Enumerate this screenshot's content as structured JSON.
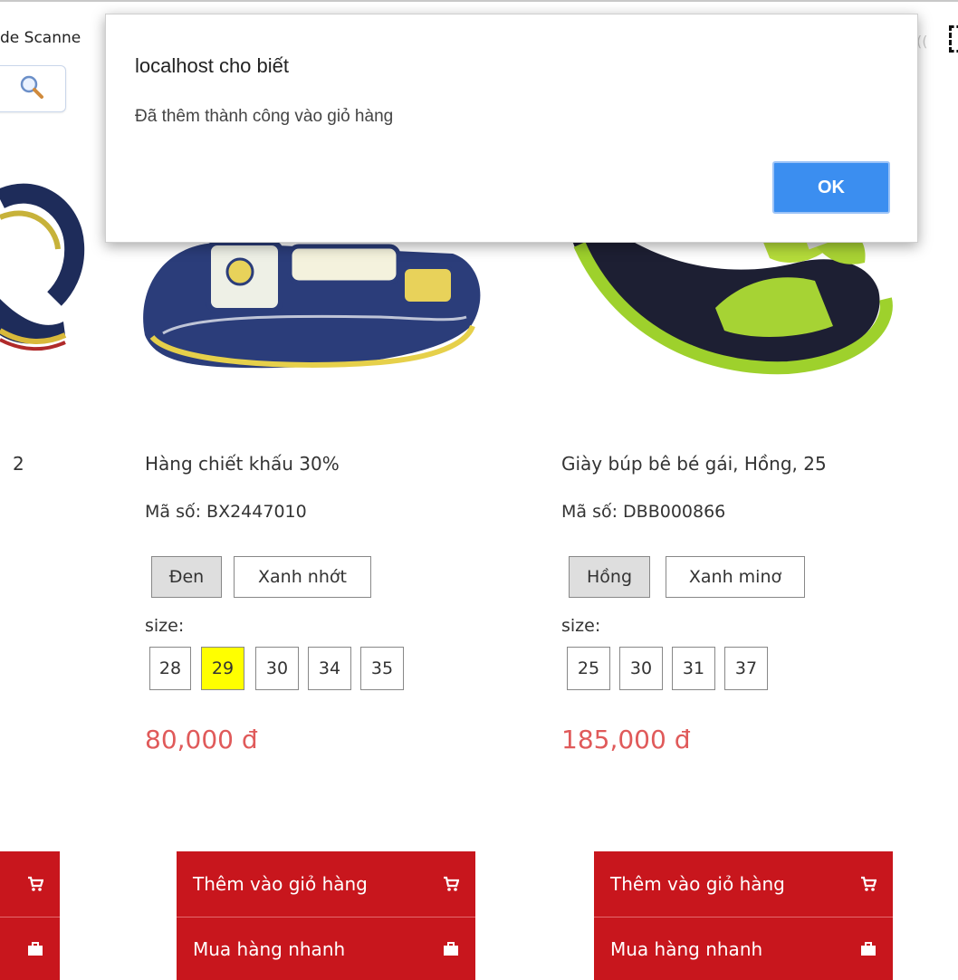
{
  "browser": {
    "bookmark_text": "de Scanne",
    "right_glyph": "(("
  },
  "products": [
    {
      "title_fragment": "2",
      "buttons": {
        "add_to_cart_icon": "cart-icon",
        "buy_now_icon": "briefcase-icon"
      }
    },
    {
      "title": "Hàng chiết khấu 30%",
      "code": "Mã số: BX2447010",
      "colors": [
        "Đen",
        "Xanh nhớt"
      ],
      "selected_color": "Đen",
      "size_label": "size:",
      "sizes": [
        "28",
        "29",
        "30",
        "34",
        "35"
      ],
      "active_size": "29",
      "price": "80,000 đ",
      "add_to_cart": "Thêm vào giỏ hàng",
      "buy_now": "Mua hàng nhanh"
    },
    {
      "title": "Giày búp bê bé gái, Hồng, 25",
      "code": "Mã số: DBB000866",
      "colors": [
        "Hồng",
        "Xanh minơ"
      ],
      "selected_color": "Hồng",
      "size_label": "size:",
      "sizes": [
        "25",
        "30",
        "31",
        "37"
      ],
      "price": "185,000 đ",
      "add_to_cart": "Thêm vào giỏ hàng",
      "buy_now": "Mua hàng nhanh"
    }
  ],
  "dialog": {
    "title": "localhost cho biết",
    "message": "Đã thêm thành công vào giỏ hàng",
    "ok_label": "OK"
  },
  "colors": {
    "price": "#e05a5a",
    "button_red": "#c8161d",
    "ok_blue": "#3b8ef0",
    "size_highlight": "#ffff00"
  }
}
